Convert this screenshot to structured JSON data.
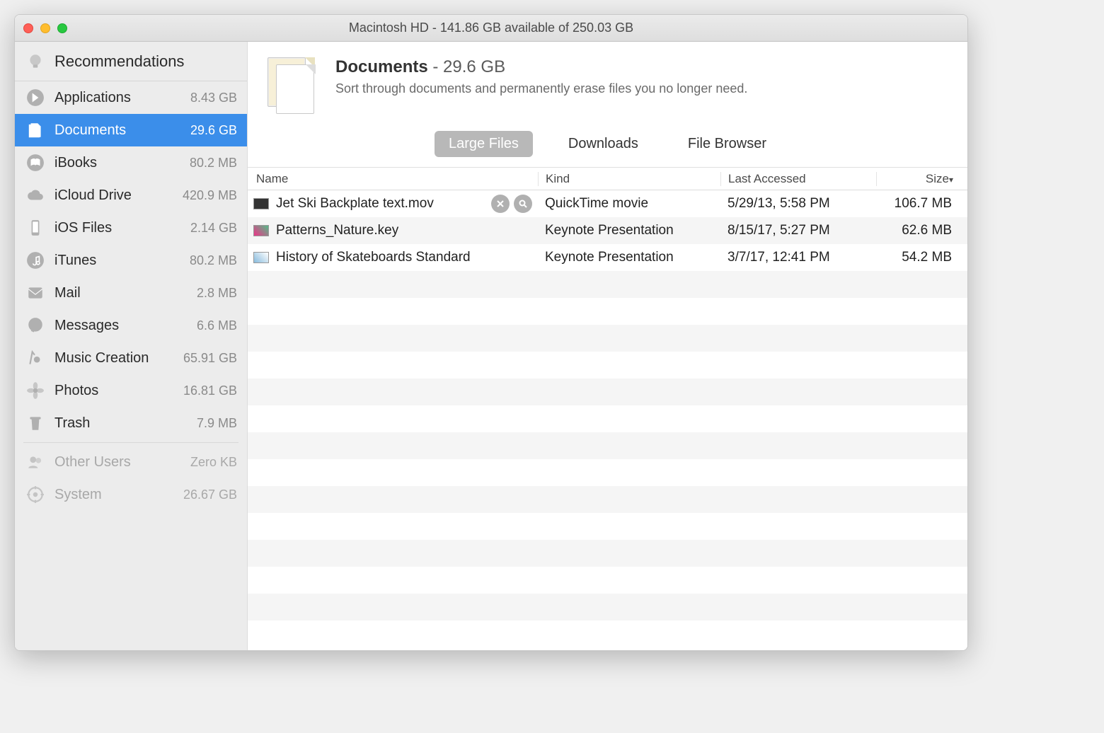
{
  "window_title": "Macintosh HD - 141.86 GB available of 250.03 GB",
  "sidebar": {
    "recommendations_label": "Recommendations",
    "items": [
      {
        "label": "Applications",
        "size": "8.43 GB",
        "icon": "apps"
      },
      {
        "label": "Documents",
        "size": "29.6 GB",
        "icon": "documents",
        "selected": true
      },
      {
        "label": "iBooks",
        "size": "80.2 MB",
        "icon": "ibooks"
      },
      {
        "label": "iCloud Drive",
        "size": "420.9 MB",
        "icon": "icloud"
      },
      {
        "label": "iOS Files",
        "size": "2.14 GB",
        "icon": "ios"
      },
      {
        "label": "iTunes",
        "size": "80.2 MB",
        "icon": "itunes"
      },
      {
        "label": "Mail",
        "size": "2.8 MB",
        "icon": "mail"
      },
      {
        "label": "Messages",
        "size": "6.6 MB",
        "icon": "messages"
      },
      {
        "label": "Music Creation",
        "size": "65.91 GB",
        "icon": "music"
      },
      {
        "label": "Photos",
        "size": "16.81 GB",
        "icon": "photos"
      },
      {
        "label": "Trash",
        "size": "7.9 MB",
        "icon": "trash"
      }
    ],
    "footer": [
      {
        "label": "Other Users",
        "size": "Zero KB",
        "icon": "users"
      },
      {
        "label": "System",
        "size": "26.67 GB",
        "icon": "system"
      }
    ]
  },
  "header": {
    "title": "Documents",
    "size": "29.6 GB",
    "subtitle": "Sort through documents and permanently erase files you no longer need."
  },
  "tabs": {
    "items": [
      "Large Files",
      "Downloads",
      "File Browser"
    ],
    "active": "Large Files"
  },
  "columns": {
    "name": "Name",
    "kind": "Kind",
    "access": "Last Accessed",
    "size": "Size"
  },
  "rows": [
    {
      "name": "Jet Ski Backplate text.mov",
      "kind": "QuickTime movie",
      "access": "5/29/13, 5:58 PM",
      "size": "106.7 MB",
      "thumb": "mov",
      "actions": true
    },
    {
      "name": "Patterns_Nature.key",
      "kind": "Keynote Presentation",
      "access": "8/15/17, 5:27 PM",
      "size": "62.6 MB",
      "thumb": "key"
    },
    {
      "name": "History of Skateboards Standard",
      "kind": "Keynote Presentation",
      "access": "3/7/17, 12:41 PM",
      "size": "54.2 MB",
      "thumb": "key2"
    }
  ]
}
